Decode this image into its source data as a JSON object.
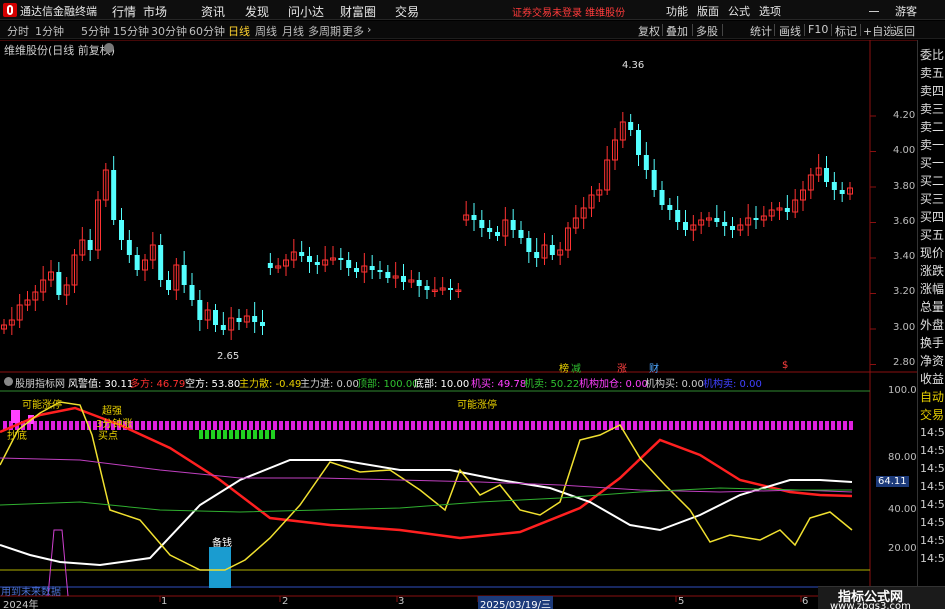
{
  "app": {
    "title": "通达信金融终端"
  },
  "menu": [
    "行情",
    "市场",
    "资讯",
    "发现",
    "问小达",
    "财富圈",
    "交易"
  ],
  "warning": "证券交易未登录   维维股份",
  "right_menu": [
    "功能",
    "版面",
    "公式",
    "选项"
  ],
  "guest": "游客",
  "periods": [
    "分时",
    "1分钟",
    "5分钟",
    "15分钟",
    "30分钟",
    "60分钟",
    "日线",
    "周线",
    "月线",
    "多周期",
    "更多"
  ],
  "active_period": "日线",
  "toolbar_right": [
    "复权",
    "叠加",
    "多股",
    "统计",
    "画线",
    "F10",
    "标记",
    "+自选",
    "返回"
  ],
  "stock_title": "维维股份(日线 前复权)",
  "price_axis": [
    "4.20",
    "4.00",
    "3.80",
    "3.60",
    "3.40",
    "3.20",
    "3.00",
    "2.80"
  ],
  "price_high_label": "4.36",
  "price_low_label": "2.65",
  "event_markers": [
    {
      "text": "榜",
      "color": "#e8d000"
    },
    {
      "text": "减",
      "color": "#30c030"
    },
    {
      "text": "涨",
      "color": "#ff4040"
    },
    {
      "text": "财",
      "color": "#4fa8ff"
    },
    {
      "text": "$",
      "color": "#ff4040"
    }
  ],
  "indicator_header": {
    "name": "股朋指标网",
    "items": [
      {
        "text": "风警值: 30.11",
        "color": "#ffffff"
      },
      {
        "text": "多方: 46.79",
        "color": "#ff3030"
      },
      {
        "text": "空方: 53.80",
        "color": "#ffffff"
      },
      {
        "text": "主力散: -0.49",
        "color": "#e8d000"
      },
      {
        "text": "主力进: 0.00",
        "color": "#cccccc"
      },
      {
        "text": "顶部: 100.00",
        "color": "#30c030"
      },
      {
        "text": "底部: 10.00",
        "color": "#ffffff"
      },
      {
        "text": "机买: 49.78",
        "color": "#ff40ff"
      },
      {
        "text": "机卖: 50.22",
        "color": "#30c030"
      },
      {
        "text": "机构加仓: 0.00",
        "color": "#ff40ff"
      },
      {
        "text": "机构买: 0.00",
        "color": "#cccccc"
      },
      {
        "text": "机构卖: 0.00",
        "color": "#4040ff"
      }
    ]
  },
  "indicator_axis": [
    "100.0",
    "80.00",
    "64.11",
    "40.00",
    "20.00"
  ],
  "annotations": {
    "possible_limit_up": "可能涨停",
    "super_strong": "超强",
    "three_minute_surge": "3分钟涨",
    "buy_point": "买点",
    "bottom_fishing": "抄底",
    "reserve_money": "备钱",
    "future_data": "用到未来数据"
  },
  "x_axis": [
    "2024年",
    "1",
    "2",
    "3",
    "2025/03/19/三",
    "5",
    "6"
  ],
  "right_panel": [
    "委比",
    "卖五",
    "卖四",
    "卖三",
    "卖二",
    "卖一",
    "买一",
    "买二",
    "买三",
    "买四",
    "买五",
    "现价",
    "涨跌",
    "涨幅",
    "总量",
    "外盘",
    "换手",
    "净资",
    "收益"
  ],
  "right_panel2": [
    "自动",
    "交易"
  ],
  "time_labels": [
    "14:5",
    "14:5",
    "14:5",
    "14:5",
    "14:5",
    "14:5",
    "14:5",
    "14:5"
  ],
  "watermark": {
    "title": "指标公式网",
    "url": "www.zbgs3.com"
  },
  "colors": {
    "up": "#ff3232",
    "down": "#54ffff",
    "accent": "#ffd22e"
  }
}
